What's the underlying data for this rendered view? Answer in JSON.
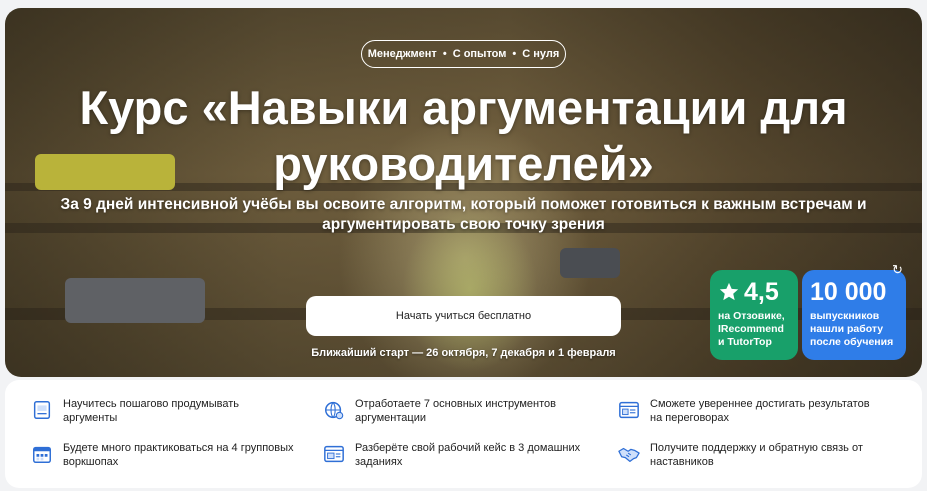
{
  "hero": {
    "tags": [
      "Менеджмент",
      "С опытом",
      "С нуля"
    ],
    "title_line1": "Курс «Навыки аргументации для",
    "title_line2": "руководителей»",
    "subtitle_line1": "За 9 дней интенсивной учёбы вы освоите алгоритм, который поможет готовиться к важным встречам и",
    "subtitle_line2": "аргументировать свою точку зрения",
    "cta_label": "Начать учиться бесплатно",
    "start_text": "Ближайший старт — 26 октября, 7 декабря и 1 февраля",
    "rating_badge": {
      "value": "4,5",
      "line1": "на Отзовике,",
      "line2": "IRecommend",
      "line3": "и TutorTop",
      "color": "#18a06a"
    },
    "graduates_badge": {
      "value": "10 000",
      "line1": "выпускников",
      "line2": "нашли работу",
      "line3": "после обучения",
      "color": "#2f7de8"
    }
  },
  "features": [
    {
      "icon": "document-icon",
      "line1": "Научитесь пошагово продумывать",
      "line2": "аргументы"
    },
    {
      "icon": "globe-tools-icon",
      "line1": "Отработаете 7 основных инструментов",
      "line2": "аргументации"
    },
    {
      "icon": "window-icon",
      "line1": "Сможете увереннее достигать результатов",
      "line2": "на переговорах"
    },
    {
      "icon": "calendar-icon",
      "line1": "Будете много практиковаться на 4 групповых",
      "line2": "воркшопах"
    },
    {
      "icon": "case-window-icon",
      "line1": "Разберёте свой рабочий кейс в 3 домашних",
      "line2": "заданиях"
    },
    {
      "icon": "handshake-icon",
      "line1": "Получите поддержку и обратную связь от",
      "line2": "наставников"
    }
  ]
}
